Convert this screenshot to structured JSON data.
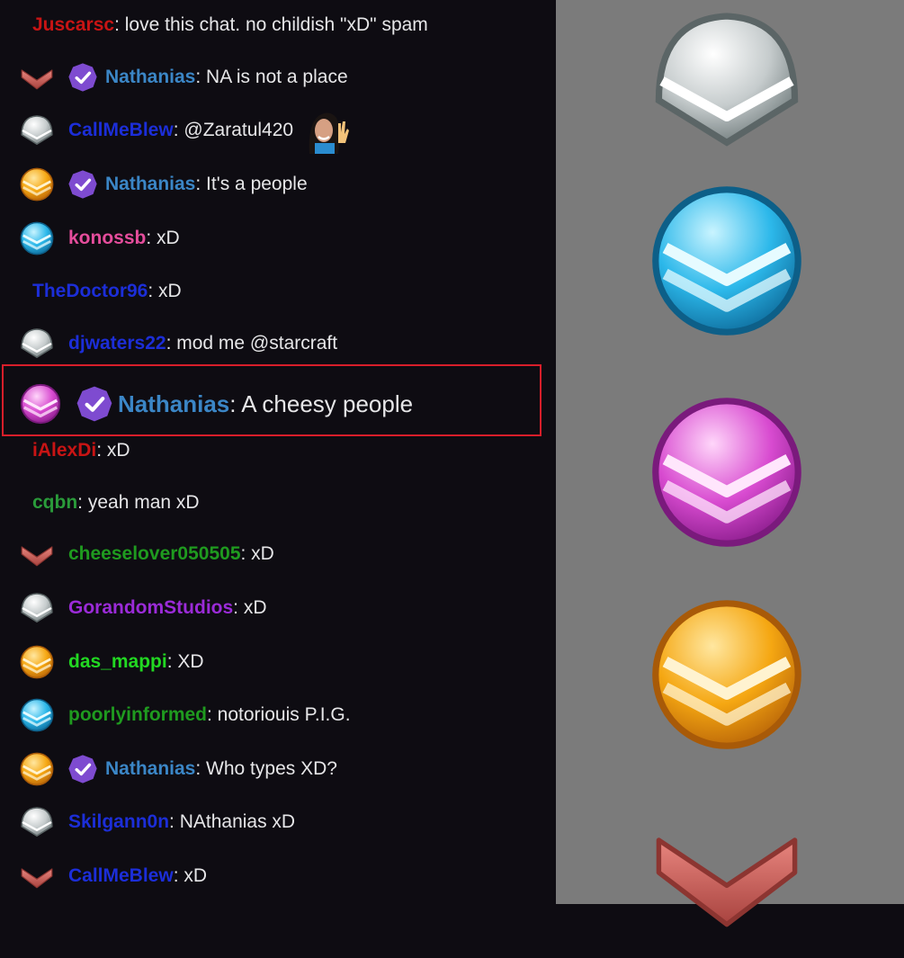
{
  "chat": {
    "messages": [
      {
        "badges": [],
        "username": "Juscarsc",
        "color": "#c81414",
        "text": ": love this chat. no childish \"xD\" spam"
      },
      {
        "badges": [
          "red-chevron-badge",
          "verified-badge"
        ],
        "username": "Nathanias",
        "color": "#3b86c6",
        "text": ": NA is not a place"
      },
      {
        "badges": [
          "silver-badge"
        ],
        "username": "CallMeBlew",
        "color": "#1c2ed8",
        "text": ": @Zaratul420",
        "emote": "waving-woman-emote"
      },
      {
        "badges": [
          "gold-badge",
          "verified-badge"
        ],
        "username": "Nathanias",
        "color": "#3b86c6",
        "text": ": It's a people"
      },
      {
        "badges": [
          "blue-badge"
        ],
        "username": "konossb",
        "color": "#e54d9c",
        "text": ": xD"
      },
      {
        "badges": [],
        "username": "TheDoctor96",
        "color": "#1c2ed8",
        "text": ": xD"
      },
      {
        "badges": [
          "silver-badge"
        ],
        "username": "djwaters22",
        "color": "#1c2ed8",
        "text": ": mod me @starcraft"
      },
      {
        "badges": [
          "purple-badge",
          "verified-badge"
        ],
        "username": "Nathanias",
        "color": "#3b86c6",
        "text": ": A cheesy people",
        "highlighted": true
      },
      {
        "badges": [],
        "username": "iAlexDi",
        "color": "#c81414",
        "text": ": xD"
      },
      {
        "badges": [],
        "username": "cqbn",
        "color": "#2a9b3a",
        "text": ": yeah man xD"
      },
      {
        "badges": [
          "red-chevron-badge"
        ],
        "username": "cheeselover050505",
        "color": "#1f9a1f",
        "text": ": xD"
      },
      {
        "badges": [
          "silver-badge"
        ],
        "username": "GorandomStudios",
        "color": "#9b2bd8",
        "text": ": xD"
      },
      {
        "badges": [
          "gold-badge"
        ],
        "username": "das_mappi",
        "color": "#22d822",
        "text": ": XD"
      },
      {
        "badges": [
          "blue-badge"
        ],
        "username": "poorlyinformed",
        "color": "#1f9a1f",
        "text": ": notoriouis P.I.G."
      },
      {
        "badges": [
          "gold-badge",
          "verified-badge"
        ],
        "username": "Nathanias",
        "color": "#3b86c6",
        "text": ": Who types XD?"
      },
      {
        "badges": [
          "silver-badge"
        ],
        "username": "Skilgann0n",
        "color": "#1c2ed8",
        "text": ": NAthanias xD"
      },
      {
        "badges": [
          "red-chevron-badge"
        ],
        "username": "CallMeBlew",
        "color": "#1c2ed8",
        "text": ": xD"
      }
    ]
  },
  "badge_panel": {
    "badges": [
      "silver-badge",
      "blue-badge",
      "purple-badge",
      "gold-badge",
      "red-chevron-badge"
    ]
  },
  "colors": {
    "highlight_border": "#d81e2a",
    "chat_bg": "#0e0c12",
    "panel_bg": "#7b7b7b"
  }
}
